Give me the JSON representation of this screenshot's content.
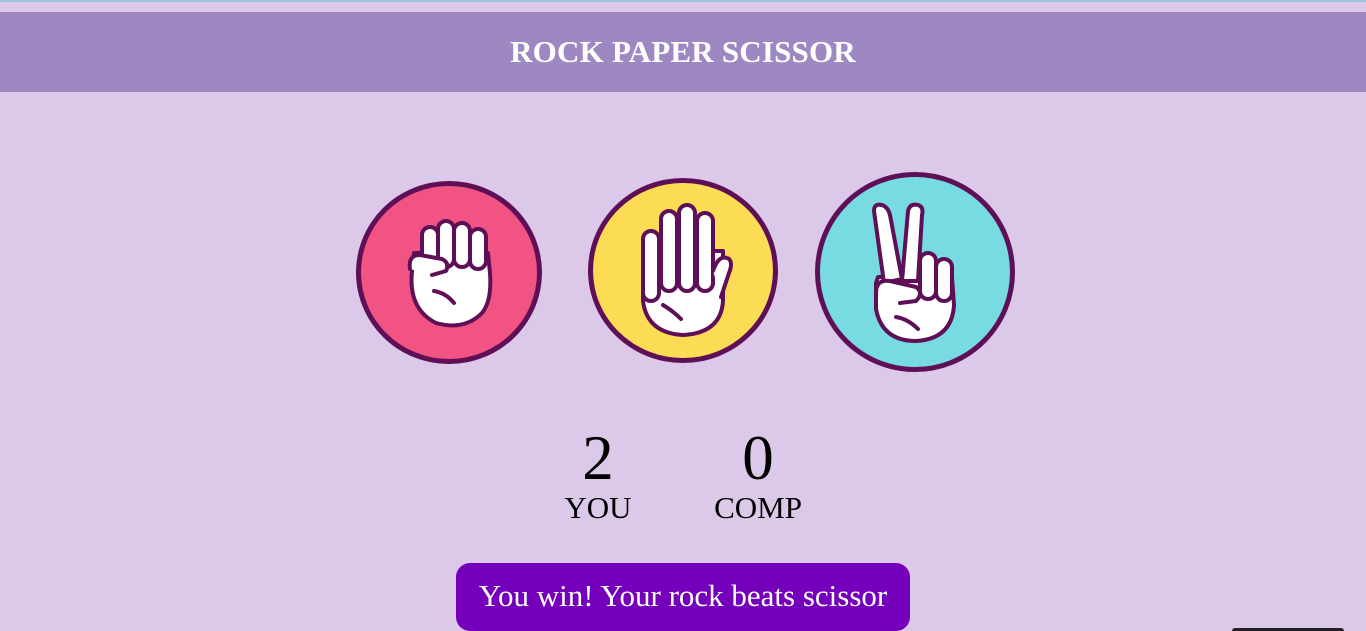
{
  "header": {
    "title": "ROCK PAPER SCISSOR"
  },
  "choices": [
    {
      "id": "rock",
      "icon": "fist-icon",
      "color": "#f15483"
    },
    {
      "id": "paper",
      "icon": "open-hand-icon",
      "color": "#fddc55"
    },
    {
      "id": "scissor",
      "icon": "peace-hand-icon",
      "color": "#77dbe1"
    }
  ],
  "scoreboard": {
    "user": {
      "score": "2",
      "label": "YOU"
    },
    "computer": {
      "score": "0",
      "label": "COMP"
    }
  },
  "message": {
    "text": "You win! Your rock beats scissor",
    "color": "#7500bb"
  },
  "colors": {
    "background": "#dcc8e8",
    "header": "#9d88c1",
    "outline": "#5e0f57"
  }
}
